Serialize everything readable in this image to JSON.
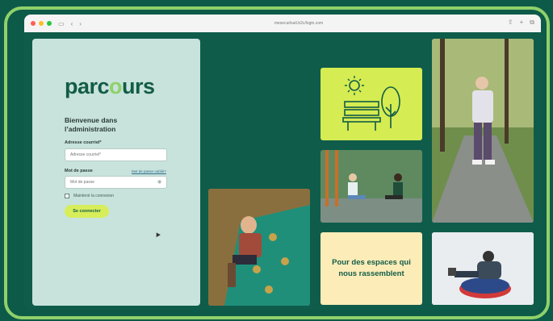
{
  "browser": {
    "address": "mesecurlsuit.b2c/login.com"
  },
  "login": {
    "logo_start": "parc",
    "logo_accent": "o",
    "logo_end": "urs",
    "welcome": "Bienvenue dans l’administration",
    "email_label": "Adresse courriel*",
    "email_placeholder": "Adresse courriel*",
    "password_label": "Mot de passe",
    "password_placeholder": "Mot de passe",
    "forgot_link": "Mot de passe oublié?",
    "remember": "Maintenir la connexion",
    "submit": "Se connecter"
  },
  "tiles": {
    "quote": "Pour des espaces qui nous rassemblent"
  },
  "colors": {
    "brand_dark": "#135c47",
    "brand_light": "#8fd16a",
    "accent_yellow": "#d7ee5a",
    "cream": "#fcecb8"
  }
}
